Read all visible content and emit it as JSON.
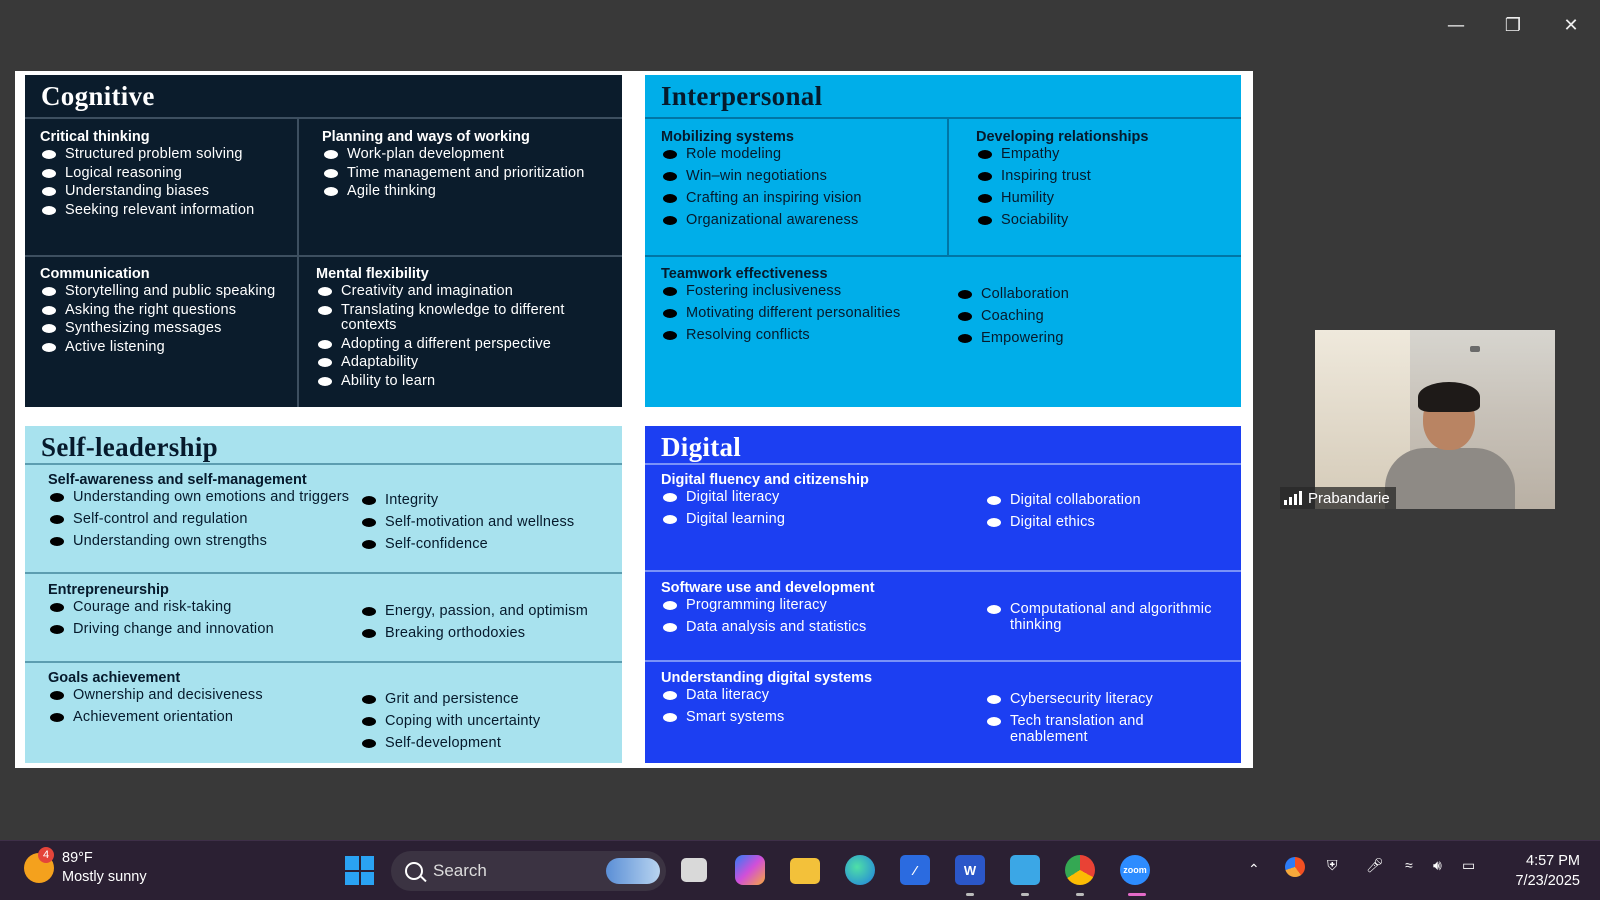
{
  "window": {
    "minimize_icon": "minimize-icon",
    "restore_icon": "restore-icon",
    "close_icon": "close-icon"
  },
  "slide": {
    "cognitive": {
      "title": "Cognitive",
      "critical": {
        "heading": "Critical thinking",
        "items": [
          "Structured problem solving",
          "Logical reasoning",
          "Understanding biases",
          "Seeking relevant information"
        ]
      },
      "planning": {
        "heading": "Planning and ways of working",
        "items": [
          "Work-plan development",
          "Time management and prioritization",
          "Agile thinking"
        ]
      },
      "communication": {
        "heading": "Communication",
        "items": [
          "Storytelling and public speaking",
          "Asking the right questions",
          "Synthesizing messages",
          "Active listening"
        ]
      },
      "mental": {
        "heading": "Mental flexibility",
        "items": [
          "Creativity and imagination",
          "Translating knowledge to different contexts",
          "Adopting a different perspective",
          "Adaptability",
          "Ability to learn"
        ]
      }
    },
    "interpersonal": {
      "title": "Interpersonal",
      "mobilizing": {
        "heading": "Mobilizing systems",
        "items": [
          "Role modeling",
          "Win–win negotiations",
          "Crafting an inspiring vision",
          "Organizational awareness"
        ]
      },
      "developing": {
        "heading": "Developing relationships",
        "items": [
          "Empathy",
          "Inspiring trust",
          "Humility",
          "Sociability"
        ]
      },
      "teamwork": {
        "heading": "Teamwork effectiveness",
        "items_left": [
          "Fostering inclusiveness",
          "Motivating different personalities",
          "Resolving conflicts"
        ],
        "items_right": [
          "Collaboration",
          "Coaching",
          "Empowering"
        ]
      }
    },
    "self_leadership": {
      "title": "Self-leadership",
      "awareness": {
        "heading": "Self-awareness and self-management",
        "items_left": [
          "Understanding own emotions and triggers",
          "Self-control and regulation",
          "Understanding own strengths"
        ],
        "items_right": [
          "Integrity",
          "Self-motivation and wellness",
          "Self-confidence"
        ]
      },
      "entrepreneurship": {
        "heading": "Entrepreneurship",
        "items_left": [
          "Courage and risk-taking",
          "Driving change and innovation"
        ],
        "items_right": [
          "Energy, passion, and optimism",
          "Breaking orthodoxies"
        ]
      },
      "goals": {
        "heading": "Goals achievement",
        "items_left": [
          "Ownership and decisiveness",
          "Achievement orientation"
        ],
        "items_right": [
          "Grit and persistence",
          "Coping with uncertainty",
          "Self-development"
        ]
      }
    },
    "digital": {
      "title": "Digital",
      "fluency": {
        "heading": "Digital fluency and citizenship",
        "items_left": [
          "Digital literacy",
          "Digital learning"
        ],
        "items_right": [
          "Digital collaboration",
          "Digital ethics"
        ]
      },
      "software": {
        "heading": "Software use and development",
        "items_left": [
          "Programming literacy",
          "Data analysis and statistics"
        ],
        "items_right": [
          "Computational and algorithmic thinking"
        ]
      },
      "systems": {
        "heading": "Understanding digital systems",
        "items_left": [
          "Data literacy",
          "Smart systems"
        ],
        "items_right": [
          "Cybersecurity literacy",
          "Tech translation and enablement"
        ]
      }
    }
  },
  "participant": {
    "name": "Prabandarie",
    "signal_icon": "signal-bars-icon"
  },
  "taskbar": {
    "weather_temp": "89°F",
    "weather_desc": "Mostly sunny",
    "weather_badge": "4",
    "search_label": "Search",
    "apps": [
      "task-view",
      "copilot",
      "file-explorer",
      "edge",
      "app",
      "word",
      "notepad",
      "chrome-beta",
      "zoom"
    ],
    "time": "4:57 PM",
    "date": "7/23/2025"
  }
}
